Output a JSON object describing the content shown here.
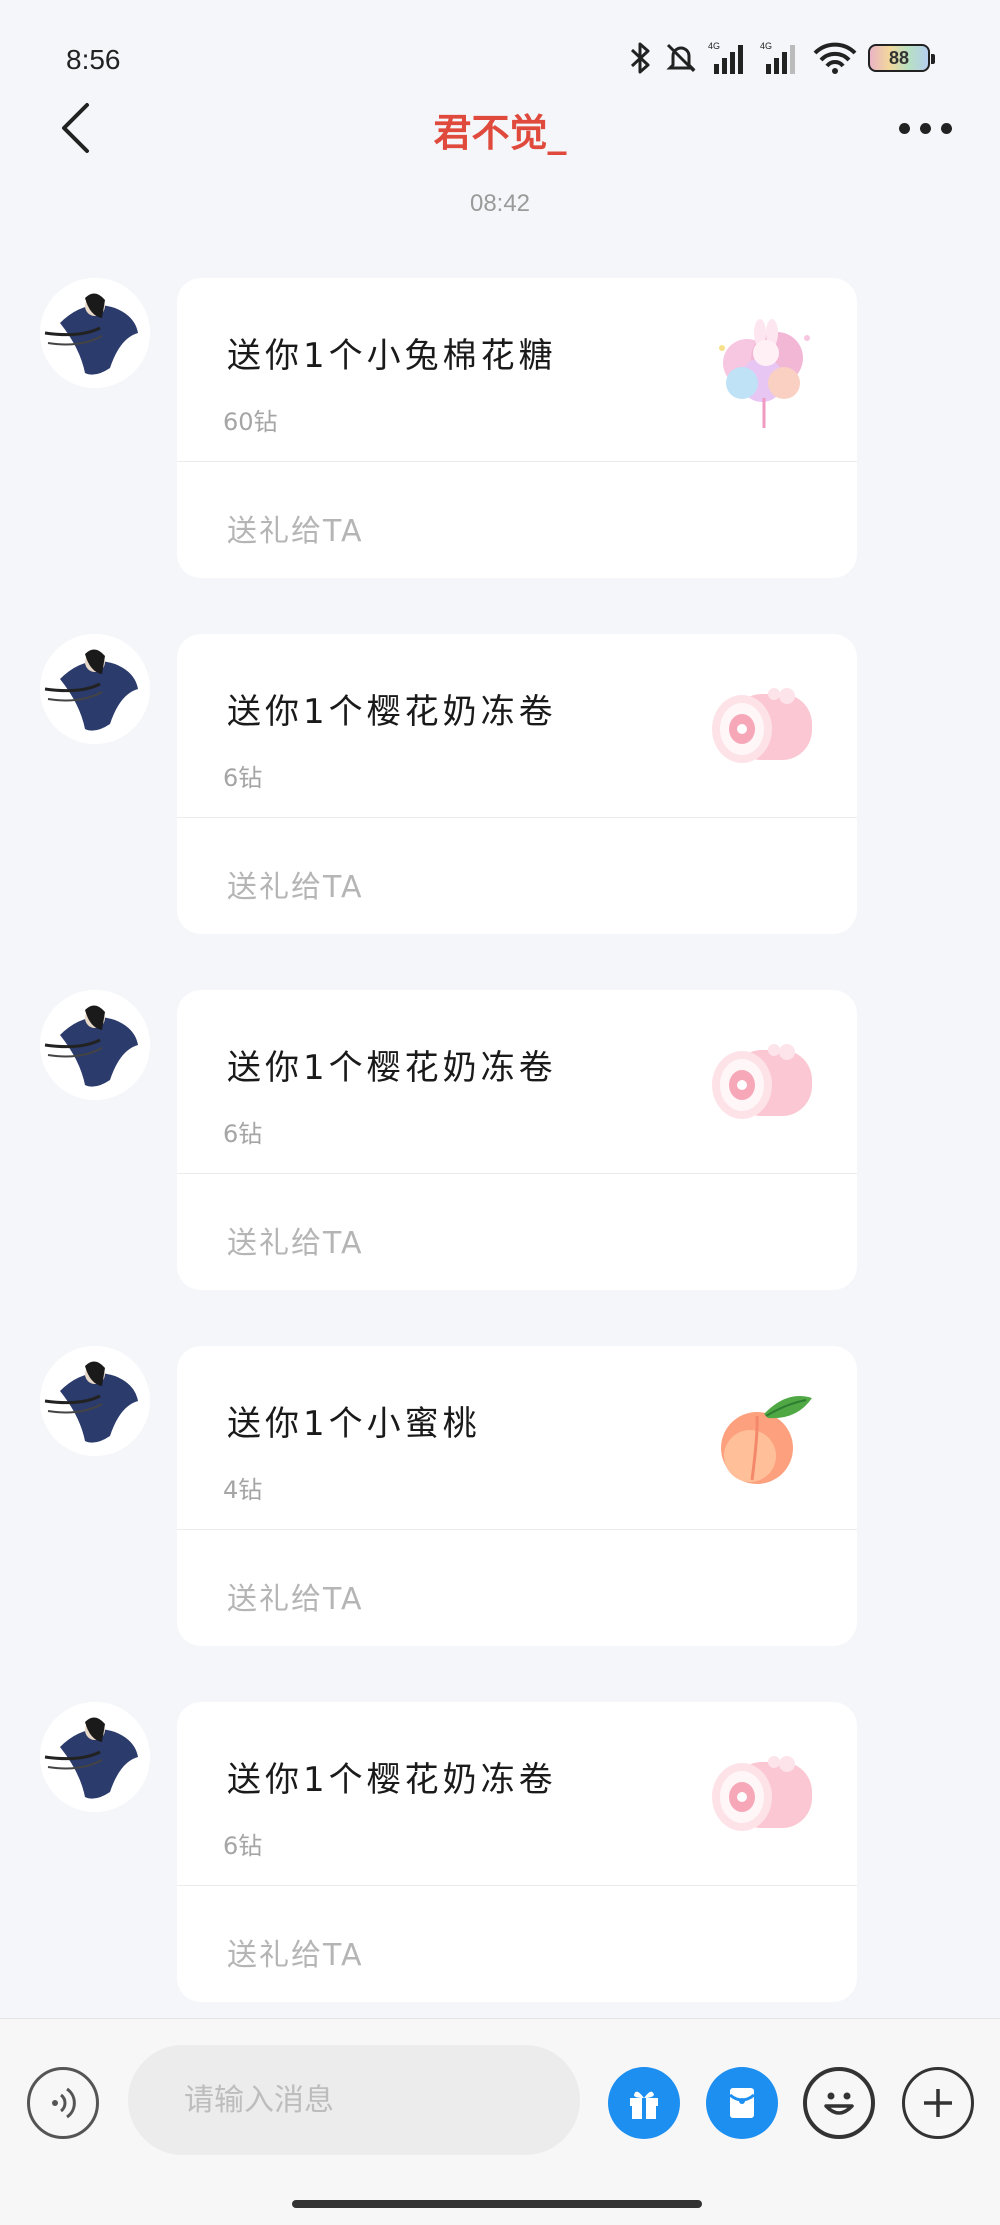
{
  "status_bar": {
    "time": "8:56",
    "battery": "88",
    "icons": [
      "bluetooth-icon",
      "mute-bell-icon",
      "signal-4g-icon",
      "signal-4g-icon",
      "wifi-icon",
      "battery-icon"
    ]
  },
  "nav": {
    "title": "君不觉_",
    "title_color": "#e04a3c",
    "back_icon": "chevron-left-icon",
    "more_icon": "more-dots-icon"
  },
  "timestamp": "08:42",
  "messages": [
    {
      "title": "送你1个小兔棉花糖",
      "price": "60钻",
      "send_label": "送礼给TA",
      "gift_icon": "cotton-candy-bunny-icon"
    },
    {
      "title": "送你1个樱花奶冻卷",
      "price": "6钻",
      "send_label": "送礼给TA",
      "gift_icon": "sakura-roll-cake-icon"
    },
    {
      "title": "送你1个樱花奶冻卷",
      "price": "6钻",
      "send_label": "送礼给TA",
      "gift_icon": "sakura-roll-cake-icon"
    },
    {
      "title": "送你1个小蜜桃",
      "price": "4钻",
      "send_label": "送礼给TA",
      "gift_icon": "peach-icon"
    },
    {
      "title": "送你1个樱花奶冻卷",
      "price": "6钻",
      "send_label": "送礼给TA",
      "gift_icon": "sakura-roll-cake-icon"
    }
  ],
  "input_bar": {
    "placeholder": "请输入消息",
    "accent_color": "#1d8ff0",
    "icons": [
      "voice-icon",
      "gift-icon",
      "red-packet-icon",
      "emoji-icon",
      "plus-icon"
    ]
  }
}
